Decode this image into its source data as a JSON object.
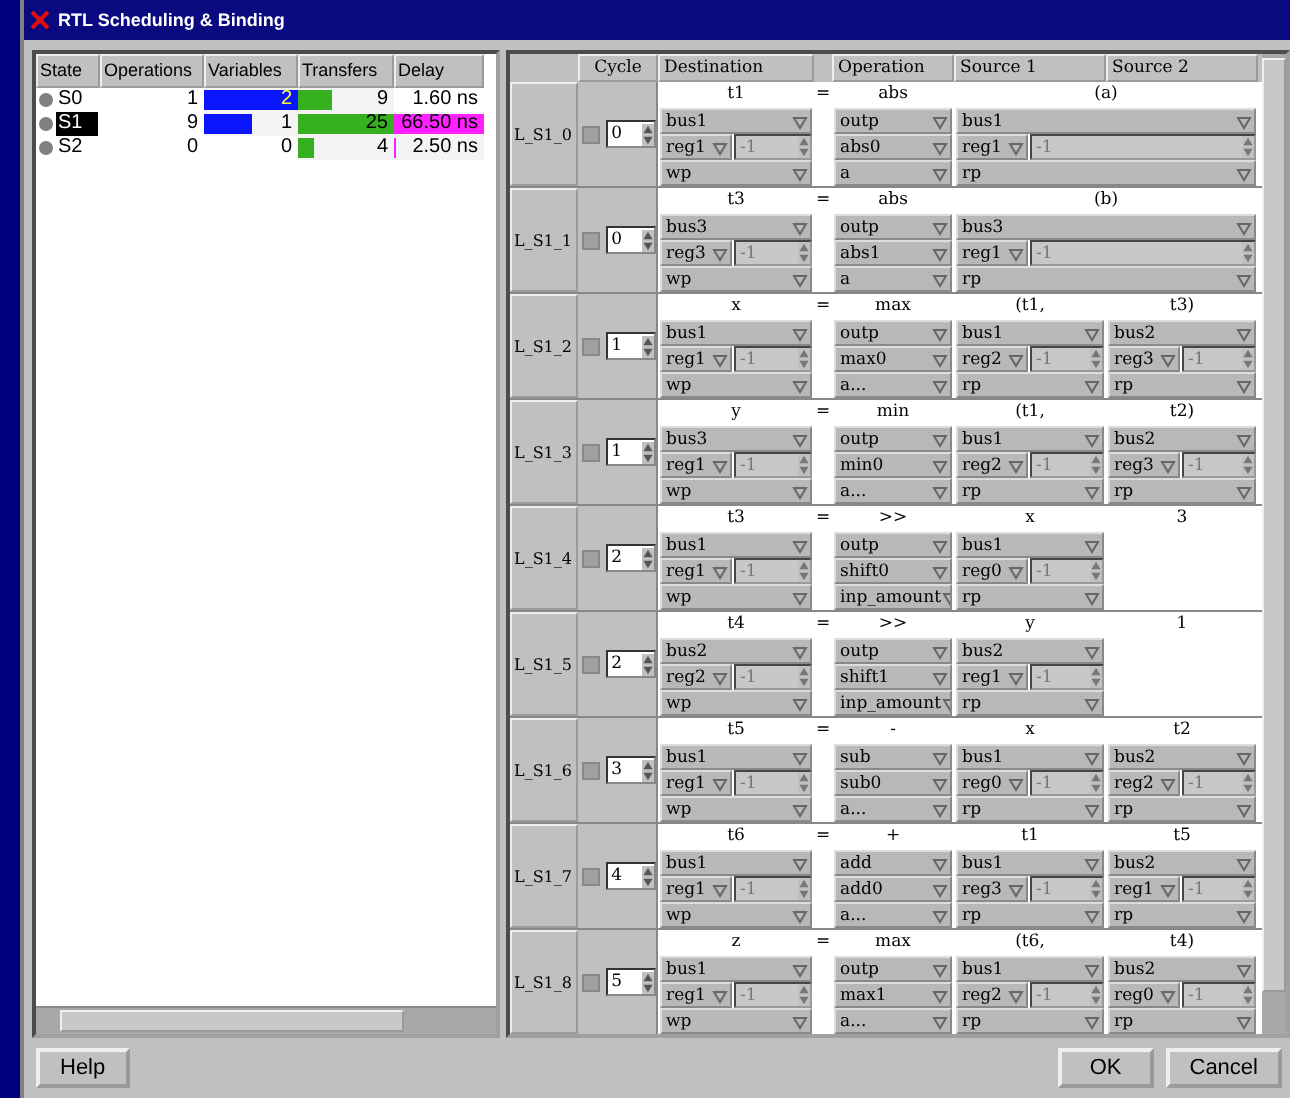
{
  "window": {
    "title": "RTL Scheduling & Binding"
  },
  "states_table": {
    "columns": [
      "State",
      "Operations",
      "Variables",
      "Transfers",
      "Delay"
    ],
    "rows": [
      {
        "state": "S0",
        "selected": false,
        "operations": "1",
        "variables": {
          "value": "2",
          "level": 1
        },
        "transfers": {
          "value": "9",
          "level": 0.36
        },
        "delay": {
          "value": "1.60 ns"
        }
      },
      {
        "state": "S1",
        "selected": true,
        "operations": "9",
        "variables": {
          "value": "1",
          "level": 0.5
        },
        "transfers": {
          "value": "25",
          "level": 1
        },
        "delay": {
          "value": "66.50 ns",
          "level": 1
        }
      },
      {
        "state": "S2",
        "selected": false,
        "operations": "0",
        "variables": {
          "value": "0"
        },
        "transfers": {
          "value": "4",
          "level": 0.16
        },
        "delay": {
          "value": "2.50 ns",
          "level": 0.03
        }
      }
    ]
  },
  "schedule": {
    "columns": [
      "Cycle",
      "Destination",
      "Operation",
      "Source 1",
      "Source 2"
    ],
    "rows": [
      {
        "label": "L_S1_0",
        "checked": false,
        "cycle": "0",
        "destination": {
          "name": "t1",
          "bus": "bus1",
          "reg": "reg1",
          "index": "-1",
          "port": "wp"
        },
        "sign": "=",
        "operation": {
          "name": "abs",
          "unit": "outp",
          "instance": "abs0",
          "port": "a"
        },
        "sources": [
          {
            "name": "(a)",
            "bus": "bus1",
            "reg": "reg1",
            "index": "-1",
            "port": "rp"
          }
        ]
      },
      {
        "label": "L_S1_1",
        "checked": false,
        "cycle": "0",
        "destination": {
          "name": "t3",
          "bus": "bus3",
          "reg": "reg3",
          "index": "-1",
          "port": "wp"
        },
        "sign": "=",
        "operation": {
          "name": "abs",
          "unit": "outp",
          "instance": "abs1",
          "port": "a"
        },
        "sources": [
          {
            "name": "(b)",
            "bus": "bus3",
            "reg": "reg1",
            "index": "-1",
            "port": "rp"
          }
        ]
      },
      {
        "label": "L_S1_2",
        "checked": false,
        "cycle": "1",
        "destination": {
          "name": "x",
          "bus": "bus1",
          "reg": "reg1",
          "index": "-1",
          "port": "wp"
        },
        "sign": "=",
        "operation": {
          "name": "max",
          "unit": "outp",
          "instance": "max0",
          "port": "a..."
        },
        "sources": [
          {
            "name": "(t1,",
            "bus": "bus1",
            "reg": "reg2",
            "index": "-1",
            "port": "rp"
          },
          {
            "name": "t3)",
            "bus": "bus2",
            "reg": "reg3",
            "index": "-1",
            "port": "rp"
          }
        ]
      },
      {
        "label": "L_S1_3",
        "checked": false,
        "cycle": "1",
        "destination": {
          "name": "y",
          "bus": "bus3",
          "reg": "reg1",
          "index": "-1",
          "port": "wp"
        },
        "sign": "=",
        "operation": {
          "name": "min",
          "unit": "outp",
          "instance": "min0",
          "port": "a..."
        },
        "sources": [
          {
            "name": "(t1,",
            "bus": "bus1",
            "reg": "reg2",
            "index": "-1",
            "port": "rp"
          },
          {
            "name": "t2)",
            "bus": "bus2",
            "reg": "reg3",
            "index": "-1",
            "port": "rp"
          }
        ]
      },
      {
        "label": "L_S1_4",
        "checked": false,
        "cycle": "2",
        "destination": {
          "name": "t3",
          "bus": "bus1",
          "reg": "reg1",
          "index": "-1",
          "port": "wp"
        },
        "sign": "=",
        "operation": {
          "name": ">>",
          "unit": "outp",
          "instance": "shift0",
          "port": "inp_amount"
        },
        "sources": [
          {
            "name": "x",
            "bus": "bus1",
            "reg": "reg0",
            "index": "-1",
            "port": "rp"
          },
          {
            "name": "3"
          }
        ]
      },
      {
        "label": "L_S1_5",
        "checked": false,
        "cycle": "2",
        "destination": {
          "name": "t4",
          "bus": "bus2",
          "reg": "reg2",
          "index": "-1",
          "port": "wp"
        },
        "sign": "=",
        "operation": {
          "name": ">>",
          "unit": "outp",
          "instance": "shift1",
          "port": "inp_amount"
        },
        "sources": [
          {
            "name": "y",
            "bus": "bus2",
            "reg": "reg1",
            "index": "-1",
            "port": "rp"
          },
          {
            "name": "1"
          }
        ]
      },
      {
        "label": "L_S1_6",
        "checked": false,
        "cycle": "3",
        "destination": {
          "name": "t5",
          "bus": "bus1",
          "reg": "reg1",
          "index": "-1",
          "port": "wp"
        },
        "sign": "=",
        "operation": {
          "name": "-",
          "unit": "sub",
          "instance": "sub0",
          "port": "a..."
        },
        "sources": [
          {
            "name": "x",
            "bus": "bus1",
            "reg": "reg0",
            "index": "-1",
            "port": "rp"
          },
          {
            "name": "t2",
            "bus": "bus2",
            "reg": "reg2",
            "index": "-1",
            "port": "rp"
          }
        ]
      },
      {
        "label": "L_S1_7",
        "checked": false,
        "cycle": "4",
        "destination": {
          "name": "t6",
          "bus": "bus1",
          "reg": "reg1",
          "index": "-1",
          "port": "wp"
        },
        "sign": "=",
        "operation": {
          "name": "+",
          "unit": "add",
          "instance": "add0",
          "port": "a..."
        },
        "sources": [
          {
            "name": "t1",
            "bus": "bus1",
            "reg": "reg3",
            "index": "-1",
            "port": "rp"
          },
          {
            "name": "t5",
            "bus": "bus2",
            "reg": "reg1",
            "index": "-1",
            "port": "rp"
          }
        ]
      },
      {
        "label": "L_S1_8",
        "checked": false,
        "cycle": "5",
        "destination": {
          "name": "z",
          "bus": "bus1",
          "reg": "reg1",
          "index": "-1",
          "port": "wp"
        },
        "sign": "=",
        "operation": {
          "name": "max",
          "unit": "outp",
          "instance": "max1",
          "port": "a..."
        },
        "sources": [
          {
            "name": "(t6,",
            "bus": "bus1",
            "reg": "reg2",
            "index": "-1",
            "port": "rp"
          },
          {
            "name": "t4)",
            "bus": "bus2",
            "reg": "reg0",
            "index": "-1",
            "port": "rp"
          }
        ]
      }
    ]
  },
  "buttons": {
    "help": "Help",
    "ok": "OK",
    "cancel": "Cancel"
  }
}
